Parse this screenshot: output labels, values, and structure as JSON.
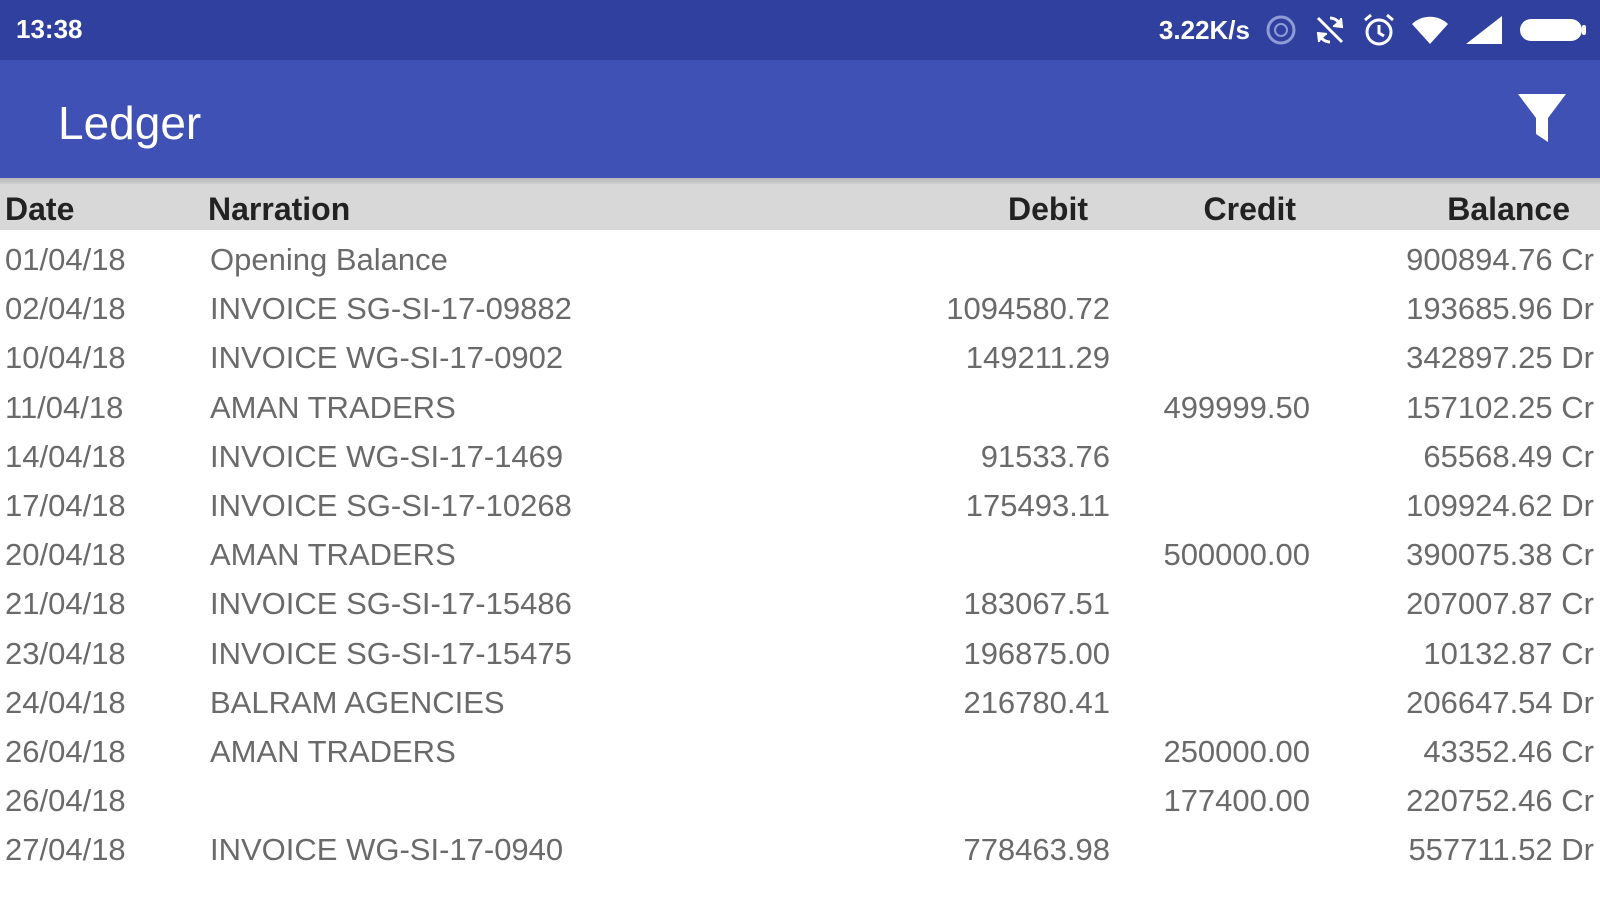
{
  "status_bar": {
    "time": "13:38",
    "net_speed": "3.22K/s",
    "icons": [
      "data-saver-icon",
      "sync-off-icon",
      "alarm-icon",
      "wifi-icon",
      "signal-icon",
      "battery-icon"
    ]
  },
  "app_bar": {
    "title": "Ledger",
    "filter_icon": "filter-icon"
  },
  "table": {
    "headers": {
      "date": "Date",
      "narration": "Narration",
      "debit": "Debit",
      "credit": "Credit",
      "balance": "Balance"
    },
    "rows": [
      {
        "date": "01/04/18",
        "narration": "Opening Balance",
        "debit": "",
        "credit": "",
        "balance": "900894.76 Cr"
      },
      {
        "date": "02/04/18",
        "narration": "INVOICE SG-SI-17-09882",
        "debit": "1094580.72",
        "credit": "",
        "balance": "193685.96 Dr"
      },
      {
        "date": "10/04/18",
        "narration": "INVOICE WG-SI-17-0902",
        "debit": "149211.29",
        "credit": "",
        "balance": "342897.25 Dr"
      },
      {
        "date": "11/04/18",
        "narration": "AMAN TRADERS",
        "debit": "",
        "credit": "499999.50",
        "balance": "157102.25 Cr"
      },
      {
        "date": "14/04/18",
        "narration": "INVOICE WG-SI-17-1469",
        "debit": "91533.76",
        "credit": "",
        "balance": "65568.49 Cr"
      },
      {
        "date": "17/04/18",
        "narration": "INVOICE SG-SI-17-10268",
        "debit": "175493.11",
        "credit": "",
        "balance": "109924.62 Dr"
      },
      {
        "date": "20/04/18",
        "narration": "AMAN TRADERS",
        "debit": "",
        "credit": "500000.00",
        "balance": "390075.38 Cr"
      },
      {
        "date": "21/04/18",
        "narration": "INVOICE SG-SI-17-15486",
        "debit": "183067.51",
        "credit": "",
        "balance": "207007.87 Cr"
      },
      {
        "date": "23/04/18",
        "narration": "INVOICE SG-SI-17-15475",
        "debit": "196875.00",
        "credit": "",
        "balance": "10132.87 Cr"
      },
      {
        "date": "24/04/18",
        "narration": "BALRAM AGENCIES",
        "debit": "216780.41",
        "credit": "",
        "balance": "206647.54 Dr"
      },
      {
        "date": "26/04/18",
        "narration": "AMAN TRADERS",
        "debit": "",
        "credit": "250000.00",
        "balance": "43352.46 Cr"
      },
      {
        "date": "26/04/18",
        "narration": "",
        "debit": "",
        "credit": "177400.00",
        "balance": "220752.46 Cr"
      },
      {
        "date": "27/04/18",
        "narration": "INVOICE WG-SI-17-0940",
        "debit": "778463.98",
        "credit": "",
        "balance": "557711.52 Dr"
      }
    ]
  }
}
